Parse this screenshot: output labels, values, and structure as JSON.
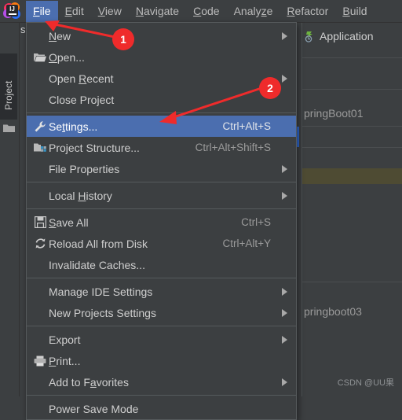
{
  "app": {
    "logo_icon": "intellij-idea-logo",
    "logo_text": "IJ"
  },
  "menubar": {
    "items": [
      {
        "label": "File",
        "mnemonic": "F",
        "active": true
      },
      {
        "label": "Edit",
        "mnemonic": "E",
        "active": false
      },
      {
        "label": "View",
        "mnemonic": "V",
        "active": false
      },
      {
        "label": "Navigate",
        "mnemonic": "N",
        "active": false
      },
      {
        "label": "Code",
        "mnemonic": "C",
        "active": false
      },
      {
        "label": "Analyze",
        "mnemonic": "z",
        "active": false
      },
      {
        "label": "Refactor",
        "mnemonic": "R",
        "active": false
      },
      {
        "label": "Build",
        "mnemonic": "B",
        "active": false
      }
    ]
  },
  "sidebar": {
    "project_tab_label": "Project",
    "project_folder_icon": "folder-icon",
    "project_title_partial": "spr"
  },
  "right_pane": {
    "run_config_label": "Application",
    "run_config_icon": "spring-boot-icon",
    "tree_item_1": "pringBoot01",
    "tree_item_2": "pringboot03"
  },
  "file_menu": {
    "title": "File",
    "groups": [
      [
        {
          "label": "New",
          "mnemonic": "N",
          "icon": null,
          "shortcut": "",
          "submenu": true,
          "selected": false
        },
        {
          "label": "Open...",
          "mnemonic": "O",
          "icon": "folder-open-icon",
          "shortcut": "",
          "submenu": false,
          "selected": false
        },
        {
          "label": "Open Recent",
          "mnemonic": "R",
          "icon": null,
          "shortcut": "",
          "submenu": true,
          "selected": false
        },
        {
          "label": "Close Project",
          "mnemonic": "",
          "icon": null,
          "shortcut": "",
          "submenu": false,
          "selected": false
        }
      ],
      [
        {
          "label": "Settings...",
          "mnemonic": "t",
          "icon": "wrench-icon",
          "shortcut": "Ctrl+Alt+S",
          "submenu": false,
          "selected": true
        },
        {
          "label": "Project Structure...",
          "mnemonic": "",
          "icon": "project-structure-icon",
          "shortcut": "Ctrl+Alt+Shift+S",
          "submenu": false,
          "selected": false
        },
        {
          "label": "File Properties",
          "mnemonic": "",
          "icon": null,
          "shortcut": "",
          "submenu": true,
          "selected": false
        }
      ],
      [
        {
          "label": "Local History",
          "mnemonic": "H",
          "icon": null,
          "shortcut": "",
          "submenu": true,
          "selected": false
        }
      ],
      [
        {
          "label": "Save All",
          "mnemonic": "S",
          "icon": "save-icon",
          "shortcut": "Ctrl+S",
          "submenu": false,
          "selected": false
        },
        {
          "label": "Reload All from Disk",
          "mnemonic": "",
          "icon": "reload-icon",
          "shortcut": "Ctrl+Alt+Y",
          "submenu": false,
          "selected": false
        },
        {
          "label": "Invalidate Caches...",
          "mnemonic": "",
          "icon": null,
          "shortcut": "",
          "submenu": false,
          "selected": false
        }
      ],
      [
        {
          "label": "Manage IDE Settings",
          "mnemonic": "",
          "icon": null,
          "shortcut": "",
          "submenu": true,
          "selected": false
        },
        {
          "label": "New Projects Settings",
          "mnemonic": "",
          "icon": null,
          "shortcut": "",
          "submenu": true,
          "selected": false
        }
      ],
      [
        {
          "label": "Export",
          "mnemonic": "",
          "icon": null,
          "shortcut": "",
          "submenu": true,
          "selected": false
        },
        {
          "label": "Print...",
          "mnemonic": "P",
          "icon": "printer-icon",
          "shortcut": "",
          "submenu": false,
          "selected": false
        },
        {
          "label": "Add to Favorites",
          "mnemonic": "a",
          "icon": null,
          "shortcut": "",
          "submenu": true,
          "selected": false
        }
      ],
      [
        {
          "label": "Power Save Mode",
          "mnemonic": "",
          "icon": null,
          "shortcut": "",
          "submenu": false,
          "selected": false
        }
      ]
    ]
  },
  "annotations": [
    {
      "badge": "1",
      "points_to": "File menu bar item"
    },
    {
      "badge": "2",
      "points_to": "Settings... menu item"
    }
  ],
  "watermark": "CSDN @UU果",
  "colors": {
    "background": "#3c3f41",
    "menu_background": "#3c3f41",
    "selection_blue": "#4b6eaf",
    "annotation_red": "#ef2b2b",
    "text": "#cfcfcf",
    "shortcut_text": "#9b9b9b"
  }
}
